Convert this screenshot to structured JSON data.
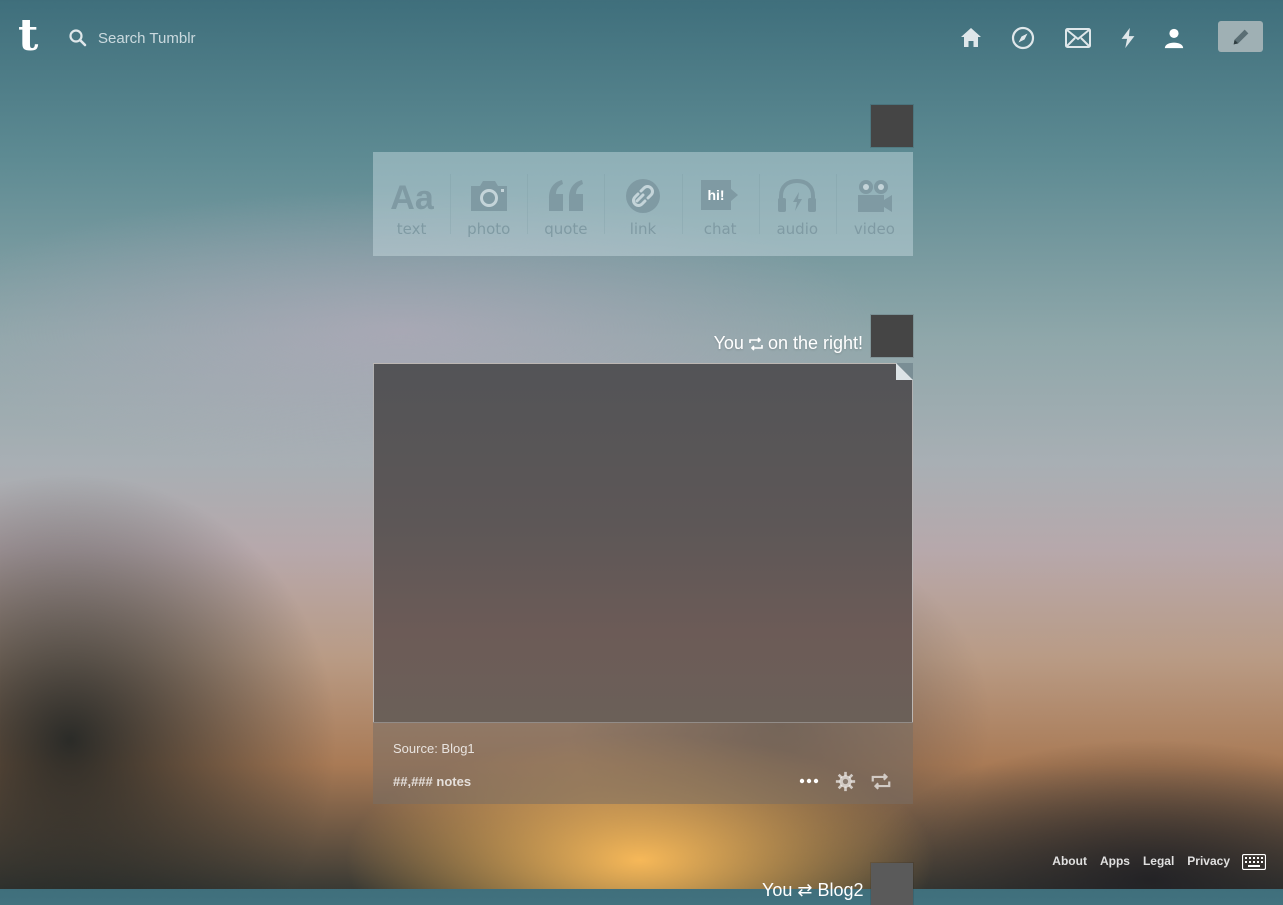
{
  "app": {
    "logo_letter": "t"
  },
  "search": {
    "placeholder": "Search Tumblr"
  },
  "nav": {
    "icons": [
      "home-icon",
      "explore-icon",
      "inbox-icon",
      "activity-icon",
      "account-icon"
    ],
    "compose_icon": "pencil-icon"
  },
  "post_types": [
    {
      "label": "text",
      "icon": "text-icon"
    },
    {
      "label": "photo",
      "icon": "camera-icon"
    },
    {
      "label": "quote",
      "icon": "quote-icon"
    },
    {
      "label": "link",
      "icon": "link-icon"
    },
    {
      "label": "chat",
      "icon": "chat-icon"
    },
    {
      "label": "audio",
      "icon": "headphones-icon"
    },
    {
      "label": "video",
      "icon": "video-camera-icon"
    }
  ],
  "post_types_glyphs": {
    "text": "Aa",
    "chat": "hi!"
  },
  "post": {
    "header_before": "You",
    "header_after": "on the right!",
    "source": "Source: Blog1",
    "notes": "##,### notes"
  },
  "footer": {
    "about": "About",
    "apps": "Apps",
    "legal": "Legal",
    "privacy": "Privacy"
  },
  "next_post": {
    "header": "You ⇄ Blog2"
  },
  "colors": {
    "avatar": "#454545",
    "compose_bg": "#9fb0b4",
    "post_type_icon": "#7f9aa3"
  }
}
